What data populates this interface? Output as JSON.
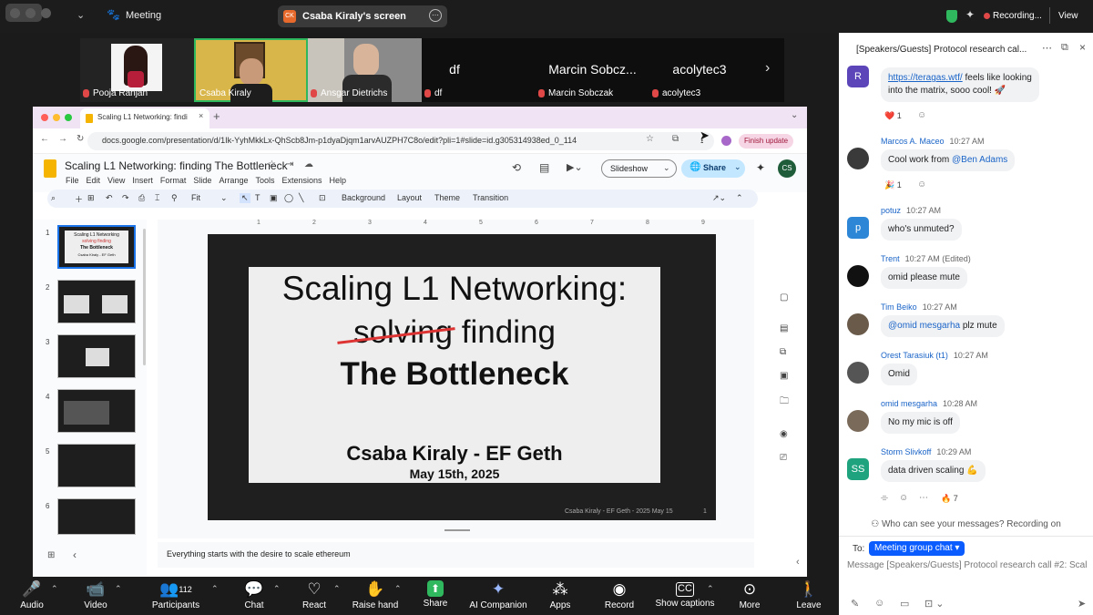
{
  "topbar": {
    "title": "Meeting",
    "share_label": "Csaba Kiraly's screen",
    "share_badge": "CK",
    "recording": "Recording...",
    "view": "View"
  },
  "participants": [
    {
      "name": "Pooja Ranjan",
      "type": "video"
    },
    {
      "name": "Csaba Kiraly",
      "type": "video",
      "active": true
    },
    {
      "name": "Ansgar Dietrichs",
      "type": "video"
    },
    {
      "name": "df",
      "type": "name"
    },
    {
      "name": "Marcin Sobczak",
      "display": "Marcin Sobcz...",
      "type": "name"
    },
    {
      "name": "acolytec3",
      "type": "name"
    }
  ],
  "browser": {
    "tab_title": "Scaling L1 Networking: findi",
    "url": "docs.google.com/presentation/d/1Ik-YyhMkkLx-QhScb8Jm-p1dyaDjqm1arvAUZPH7C8o/edit?pli=1#slide=id.g305314938ed_0_114",
    "finish_update": "Finish update",
    "doc_title": "Scaling L1 Networking: finding The Bottleneck",
    "menu": [
      "File",
      "Edit",
      "View",
      "Insert",
      "Format",
      "Slide",
      "Arrange",
      "Tools",
      "Extensions",
      "Help"
    ],
    "slideshow": "Slideshow",
    "share": "Share",
    "avatar": "CS",
    "toolbar": {
      "fit": "Fit",
      "background": "Background",
      "layout": "Layout",
      "theme": "Theme",
      "transition": "Transition"
    },
    "thumbnails": [
      "1",
      "2",
      "3",
      "4",
      "5",
      "6"
    ],
    "thumb1": {
      "l1": "Scaling L1 Networking",
      "l2": "solving finding",
      "l3": "The Bottleneck",
      "l4": "Csaba Kiraly - EF Geth"
    },
    "slide": {
      "line1": "Scaling L1 Networking:",
      "struck": "solving",
      "line2b": "finding",
      "line3": "The Bottleneck",
      "author": "Csaba Kiraly - EF Geth",
      "date": "May 15th, 2025",
      "footer": "Csaba Kiraly - EF Geth - 2025 May 15",
      "page": "1"
    },
    "ruler": [
      "1",
      "2",
      "3",
      "4",
      "5",
      "6",
      "7",
      "8",
      "9"
    ],
    "notes": "Everything starts with the desire to scale ethereum"
  },
  "bottombar": [
    {
      "label": "Audio",
      "icon": "mic-icon",
      "glyph": "🎙"
    },
    {
      "label": "Video",
      "icon": "video-icon",
      "glyph": "📹"
    },
    {
      "label": "Participants",
      "icon": "participants-icon",
      "glyph": "👥",
      "count": "112"
    },
    {
      "label": "Chat",
      "icon": "chat-icon",
      "glyph": "💬"
    },
    {
      "label": "React",
      "icon": "heart-icon",
      "glyph": "♡"
    },
    {
      "label": "Raise hand",
      "icon": "hand-icon",
      "glyph": "✋"
    },
    {
      "label": "Share",
      "icon": "share-screen-icon",
      "glyph": "⬆"
    },
    {
      "label": "AI Companion",
      "icon": "sparkle-icon",
      "glyph": "✦"
    },
    {
      "label": "Apps",
      "icon": "apps-icon",
      "glyph": "⁂"
    },
    {
      "label": "Record",
      "icon": "record-icon",
      "glyph": "◉"
    },
    {
      "label": "Show captions",
      "icon": "captions-icon",
      "glyph": "CC"
    },
    {
      "label": "More",
      "icon": "more-icon",
      "glyph": "⋯"
    },
    {
      "label": "Leave",
      "icon": "leave-icon",
      "glyph": "🚶"
    }
  ],
  "chat": {
    "title": "[Speakers/Guests] Protocol research cal...",
    "messages": [
      {
        "avatar": "R",
        "color": "#5b45b8",
        "name": "",
        "time": "",
        "link": "https://teragas.wtf/",
        "text": " feels like looking",
        "text2": "into the matrix, sooo cool! 🚀",
        "reaction": "❤️ 1"
      },
      {
        "avatar": "",
        "color": "#3a3a3a",
        "name": "Marcos A. Maceo",
        "time": "10:27 AM",
        "text": "Cool work from ",
        "mention": "@Ben Adams",
        "reaction": "🎉 1"
      },
      {
        "avatar": "p",
        "color": "#2d87d6",
        "name": "potuz",
        "time": "10:27 AM",
        "text": "who's unmuted?"
      },
      {
        "avatar": "",
        "color": "#111",
        "name": "Trent",
        "time": "10:27 AM (Edited)",
        "text": "omid please mute"
      },
      {
        "avatar": "",
        "color": "#6a5a4a",
        "name": "Tim Beiko",
        "time": "10:27 AM",
        "mention": "@omid mesgarha",
        "text": " plz mute"
      },
      {
        "avatar": "",
        "color": "#555",
        "name": "Orest Tarasiuk (t1)",
        "time": "10:27 AM",
        "text": "Omid"
      },
      {
        "avatar": "",
        "color": "#7a6a5a",
        "name": "omid mesgarha",
        "time": "10:28 AM",
        "text": "No my mic is off"
      },
      {
        "avatar": "SS",
        "color": "#1fa37f",
        "name": "Storm Slivkoff",
        "time": "10:29 AM",
        "text": "data driven scaling 💪",
        "reaction": "🔥 7"
      }
    ],
    "privacy": "Who can see your messages? Recording on",
    "to_label": "To:",
    "to_value": "Meeting group chat",
    "input_placeholder": "Message [Speakers/Guests] Protocol research call #2: Scal"
  },
  "colors": {
    "accent": "#0b5cff",
    "zoom_green": "#2fb85e",
    "leave_red": "#e04848"
  }
}
